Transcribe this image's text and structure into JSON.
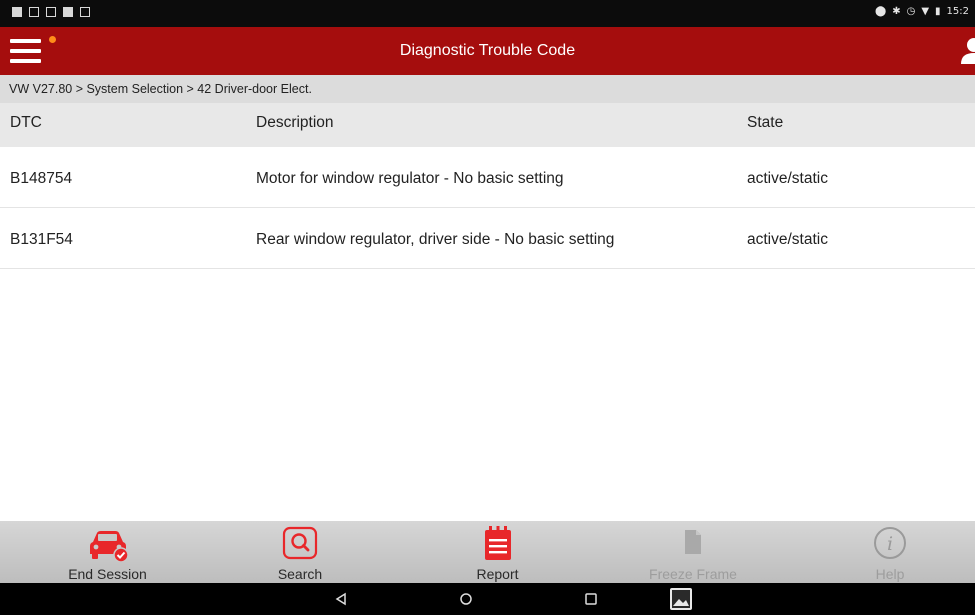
{
  "status_bar": {
    "time": "15:2"
  },
  "app_bar": {
    "title": "Diagnostic Trouble Code",
    "notification_color": "#ff8c1a"
  },
  "breadcrumb": "VW V27.80 > System Selection > 42 Driver-door Elect.",
  "table": {
    "headers": [
      "DTC",
      "Description",
      "State"
    ],
    "rows": [
      [
        "B148754",
        "Motor for window regulator - No basic setting",
        "active/static"
      ],
      [
        "B131F54",
        "Rear window regulator, driver side - No basic setting",
        "active/static"
      ]
    ]
  },
  "toolbar": {
    "end_session": "End Session",
    "search": "Search",
    "report": "Report",
    "freeze_frame": "Freeze Frame",
    "help": "Help"
  },
  "colors": {
    "brand": "#a50d0d",
    "icon_red": "#e8272a",
    "disabled": "#9d9d9d"
  }
}
